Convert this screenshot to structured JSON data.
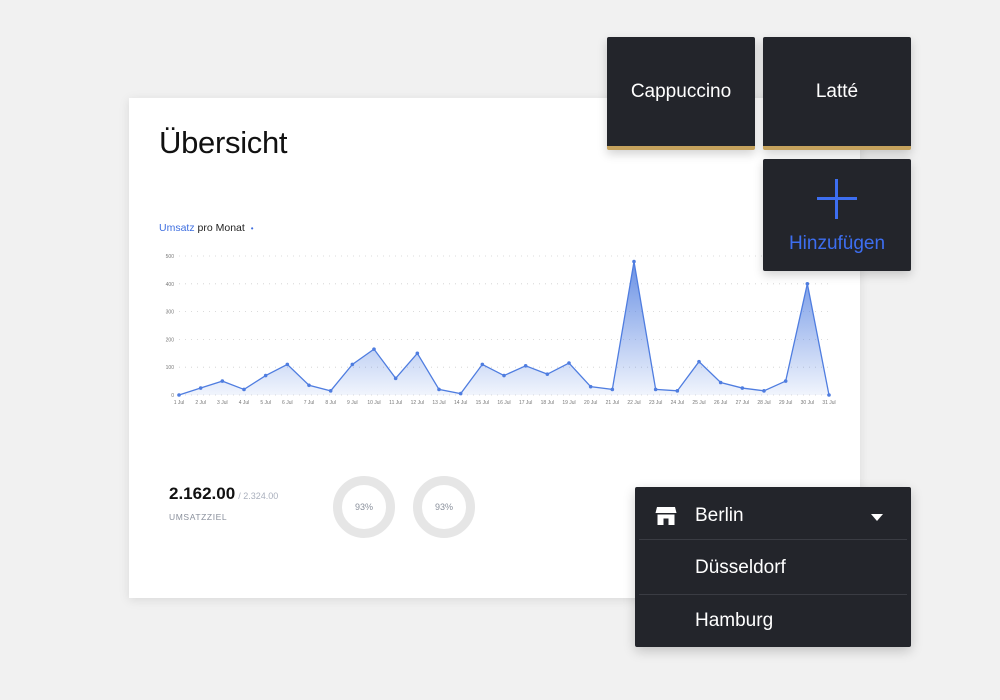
{
  "page_title": "Übersicht",
  "chart_header": {
    "accent": "Umsatz",
    "rest": " pro Monat",
    "dot": "•"
  },
  "chart_data": {
    "type": "area",
    "x": [
      "1 Jul",
      "2 Jul",
      "3 Jul",
      "4 Jul",
      "5 Jul",
      "6 Jul",
      "7 Jul",
      "8 Jul",
      "9 Jul",
      "10 Jul",
      "11 Jul",
      "12 Jul",
      "13 Jul",
      "14 Jul",
      "15 Jul",
      "16 Jul",
      "17 Jul",
      "18 Jul",
      "19 Jul",
      "20 Jul",
      "21 Jul",
      "22 Jul",
      "23 Jul",
      "24 Jul",
      "25 Jul",
      "26 Jul",
      "27 Jul",
      "28 Jul",
      "29 Jul",
      "30 Jul",
      "31 Jul"
    ],
    "values": [
      0,
      25,
      50,
      20,
      70,
      110,
      35,
      15,
      110,
      165,
      60,
      150,
      20,
      5,
      110,
      70,
      105,
      75,
      115,
      30,
      20,
      480,
      20,
      15,
      120,
      45,
      25,
      15,
      50,
      400,
      0
    ],
    "yticks": [
      0,
      100,
      200,
      300,
      400,
      500
    ],
    "ylim": [
      0,
      500
    ],
    "grid": true,
    "color": "#4f7de0"
  },
  "stats": {
    "value": "2.162.00",
    "target": "/ 2.324.00",
    "label": "UMSATZZIEL",
    "ring1": "93%",
    "ring2": "93%"
  },
  "tiles": {
    "cappuccino": "Cappuccino",
    "latte": "Latté",
    "add_label": "Hinzufügen",
    "add_icon": "plus-icon"
  },
  "locations": {
    "selected": "Berlin",
    "options": [
      "Düsseldorf",
      "Hamburg"
    ],
    "icon": "store-icon"
  },
  "colors": {
    "accent": "#3d6ef0",
    "tile_bg": "#23252b",
    "tile_bar": "#c5a25d"
  }
}
